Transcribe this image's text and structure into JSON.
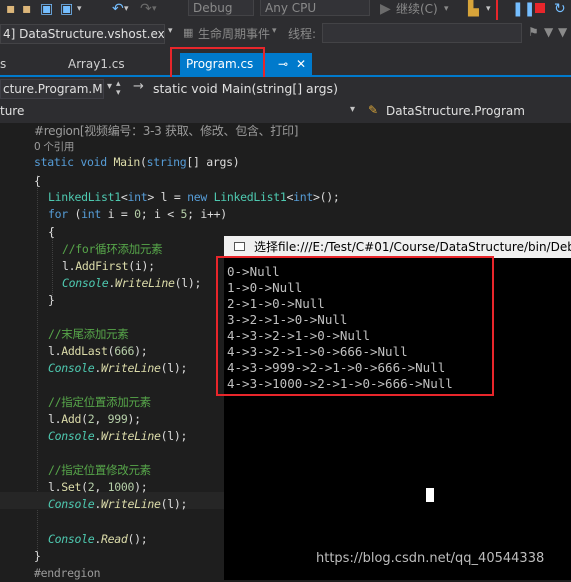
{
  "toolbar": {
    "config_dropdown": "Debug",
    "platform_dropdown": "Any CPU",
    "continue_label": "继续(C)",
    "lifecycle_label": "生命周期事件",
    "thread_label": "线程:"
  },
  "project_dropdown": "4] DataStructure.vshost.exe",
  "tabs": [
    {
      "label": "s"
    },
    {
      "label": "Array1.cs"
    },
    {
      "label": "Program.cs"
    }
  ],
  "nav": {
    "class_box": "cture.Program.M",
    "method_box": "static void Main(string[] args)",
    "scope_left": "ture",
    "scope_right": "DataStructure.Program"
  },
  "code": {
    "region": "#region[视频编号：3-3 获取、修改、包含、打印]",
    "refs": "0 个引用",
    "comment_for": "//for循环添加元素",
    "comment_tail": "//末尾添加元素",
    "comment_insert": "//指定位置添加元素",
    "comment_set": "//指定位置修改元素",
    "endregion": "#endregion"
  },
  "console": {
    "title": "选择file:///E:/Test/C#01/Course/DataStructure/bin/Debu",
    "lines": [
      "0->Null",
      "1->0->Null",
      "2->1->0->Null",
      "3->2->1->0->Null",
      "4->3->2->1->0->Null",
      "4->3->2->1->0->666->Null",
      "4->3->999->2->1->0->666->Null",
      "4->3->1000->2->1->0->666->Null"
    ]
  },
  "watermark": "https://blog.csdn.net/qq_40544338"
}
